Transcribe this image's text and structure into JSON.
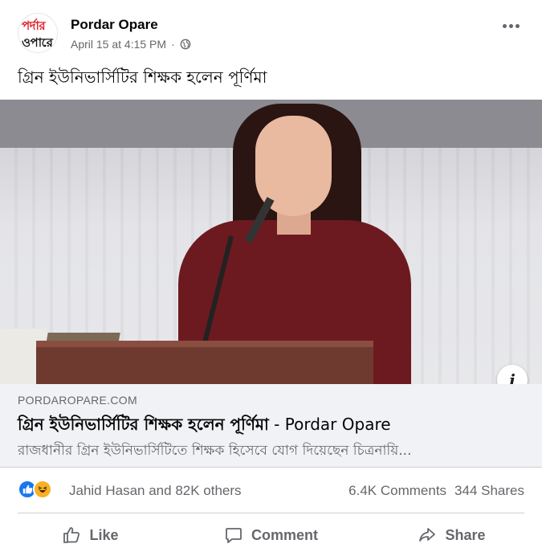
{
  "header": {
    "avatar_line1": "পর্দার",
    "avatar_line2": "ওপারে",
    "page_name": "Pordar Opare",
    "timestamp": "April 15 at 4:15 PM",
    "separator": "·",
    "privacy_icon": "globe-icon",
    "more_icon": "ellipsis-icon"
  },
  "post": {
    "text": "গ্রিন ইউনিভার্সিটির শিক্ষক হলেন পূর্ণিমা"
  },
  "photo": {
    "info_icon": "info-icon",
    "info_label": "i"
  },
  "link_preview": {
    "domain": "PORDAROPARE.COM",
    "title": "গ্রিন ইউনিভার্সিটির শিক্ষক হলেন পূর্ণিমা",
    "title_separator": " - ",
    "site_name": "Pordar Opare",
    "description": "রাজধানীর গ্রিন ইউনিভার্সিটিতে শিক্ষক হিসেবে যোগ দিয়েছেন চিত্রনায়ি..."
  },
  "stats": {
    "reaction_icons": [
      "like-icon",
      "haha-icon"
    ],
    "reaction_text": "Jahid Hasan and 82K others",
    "comments": "6.4K Comments",
    "shares": "344 Shares"
  },
  "actions": {
    "like": "Like",
    "comment": "Comment",
    "share": "Share"
  },
  "colors": {
    "accent": "#1877f2",
    "secondary_text": "#65676b",
    "link_bg": "#f0f2f5",
    "logo_red": "#e0202a"
  }
}
